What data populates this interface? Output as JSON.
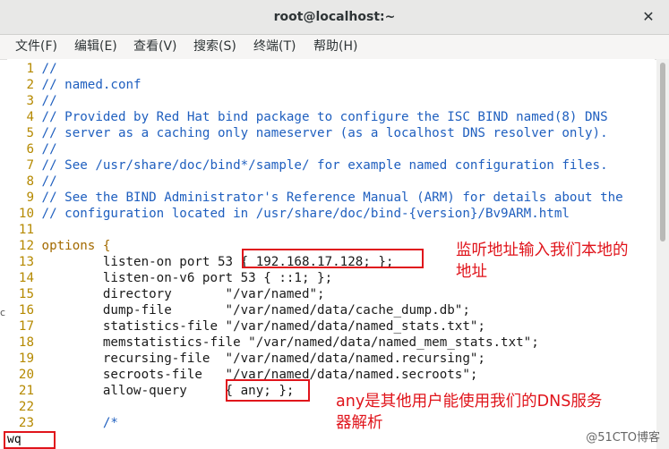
{
  "window": {
    "title": "root@localhost:~"
  },
  "menu": [
    "文件(F)",
    "编辑(E)",
    "查看(V)",
    "搜索(S)",
    "终端(T)",
    "帮助(H)"
  ],
  "lines": [
    {
      "n": "1",
      "cls": "cm",
      "text": "//"
    },
    {
      "n": "2",
      "cls": "cm",
      "text": "// named.conf"
    },
    {
      "n": "3",
      "cls": "cm",
      "text": "//"
    },
    {
      "n": "4",
      "cls": "cm",
      "text": "// Provided by Red Hat bind package to configure the ISC BIND named(8) DNS"
    },
    {
      "n": "5",
      "cls": "cm",
      "text": "// server as a caching only nameserver (as a localhost DNS resolver only)."
    },
    {
      "n": "6",
      "cls": "cm",
      "text": "//"
    },
    {
      "n": "7",
      "cls": "cm",
      "text": "// See /usr/share/doc/bind*/sample/ for example named configuration files."
    },
    {
      "n": "8",
      "cls": "cm",
      "text": "//"
    },
    {
      "n": "9",
      "cls": "cm",
      "text": "// See the BIND Administrator's Reference Manual (ARM) for details about the"
    },
    {
      "n": "10",
      "cls": "cm",
      "text": "// configuration located in /usr/share/doc/bind-{version}/Bv9ARM.html"
    },
    {
      "n": "11",
      "cls": "code",
      "text": ""
    },
    {
      "n": "12",
      "cls": "kw",
      "text": "options {"
    },
    {
      "n": "13",
      "cls": "code",
      "text": "        listen-on port 53 { 192.168.17.128; };"
    },
    {
      "n": "14",
      "cls": "code",
      "text": "        listen-on-v6 port 53 { ::1; };"
    },
    {
      "n": "15",
      "cls": "code",
      "text": "        directory       \"/var/named\";"
    },
    {
      "n": "16",
      "cls": "code",
      "text": "        dump-file       \"/var/named/data/cache_dump.db\";"
    },
    {
      "n": "17",
      "cls": "code",
      "text": "        statistics-file \"/var/named/data/named_stats.txt\";"
    },
    {
      "n": "18",
      "cls": "code",
      "text": "        memstatistics-file \"/var/named/data/named_mem_stats.txt\";"
    },
    {
      "n": "19",
      "cls": "code",
      "text": "        recursing-file  \"/var/named/data/named.recursing\";"
    },
    {
      "n": "20",
      "cls": "code",
      "text": "        secroots-file   \"/var/named/data/named.secroots\";"
    },
    {
      "n": "21",
      "cls": "code",
      "text": "        allow-query     { any; };"
    },
    {
      "n": "22",
      "cls": "code",
      "text": ""
    },
    {
      "n": "23",
      "cls": "cm",
      "text": "        /*"
    }
  ],
  "cmdline": "wq",
  "annotations": {
    "note1": "监听地址输入我们本地的\n地址",
    "note2": "any是其他用户能使用我们的DNS服务\n器解析"
  },
  "edge_mark": "c",
  "watermark": "@51CTO博客",
  "colors": {
    "annotation": "#e0141b",
    "line_number": "#b58900",
    "comment": "#1f5fbf",
    "keyword": "#a36a00"
  }
}
